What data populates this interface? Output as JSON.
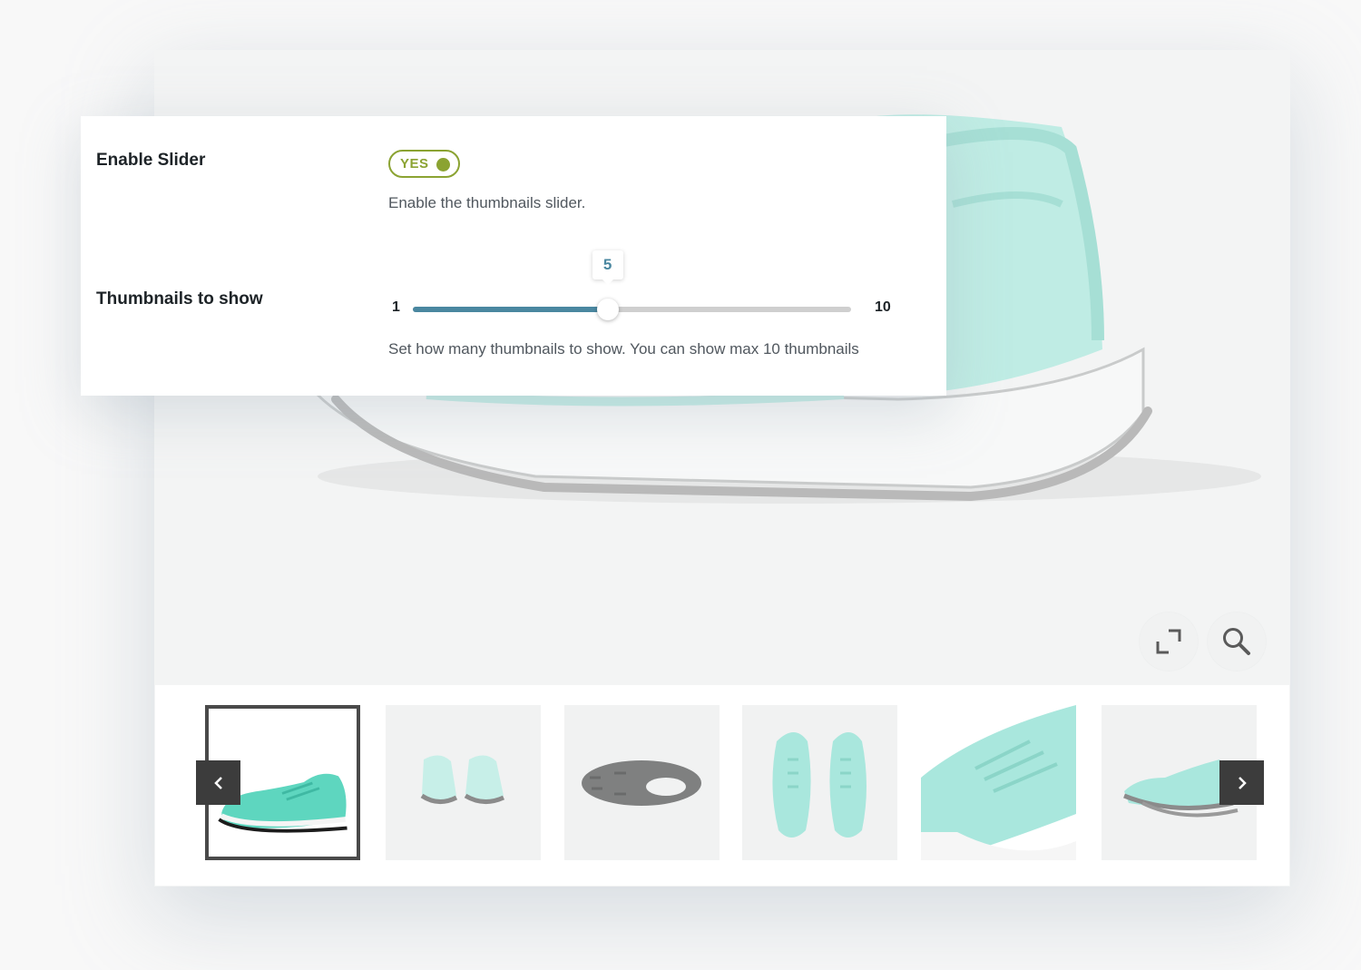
{
  "settings": {
    "enable_slider": {
      "label": "Enable Slider",
      "toggle_text": "YES",
      "description": "Enable the thumbnails slider."
    },
    "thumbnails_to_show": {
      "label": "Thumbnails to show",
      "min": "1",
      "max": "10",
      "value": "5",
      "description": "Set how many thumbnails to show. You can show max 10 thumbnails"
    }
  },
  "gallery": {
    "buttons": [
      "fullscreen-icon",
      "zoom-icon"
    ],
    "thumbnails": [
      "shoe-side-view",
      "shoe-back-view",
      "shoe-sole-view",
      "shoe-top-view",
      "shoe-closeup-view",
      "shoe-pair-side-view"
    ],
    "active_thumbnail": 1,
    "nav": [
      "chevron-left-icon",
      "chevron-right-icon"
    ]
  },
  "colors": {
    "accent_toggle": "#8ba332",
    "accent_slider": "#4a87a0",
    "shoe_mint": "#a9e7dd"
  }
}
